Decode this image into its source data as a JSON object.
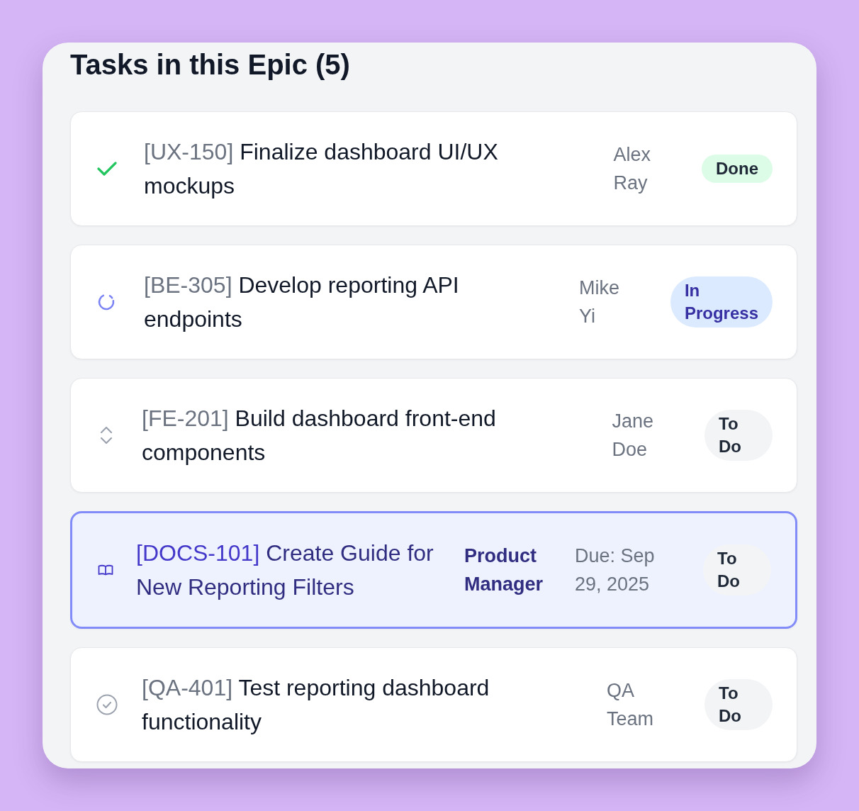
{
  "panel": {
    "title": "Tasks in this Epic (5)"
  },
  "tasks": [
    {
      "kind": "done",
      "selected": false,
      "key": "[UX-150]",
      "title": "Finalize dashboard UI/UX mockups",
      "assignee": "Alex Ray",
      "status": {
        "kind": "done",
        "label": "Done"
      }
    },
    {
      "kind": "in_progress",
      "selected": false,
      "key": "[BE-305]",
      "title": "Develop reporting API endpoints",
      "assignee": "Mike Yi",
      "status": {
        "kind": "in_progress",
        "label": "In Progress"
      }
    },
    {
      "kind": "todo",
      "selected": false,
      "key": "[FE-201]",
      "title": "Build dashboard front-end components",
      "assignee": "Jane Doe",
      "status": {
        "kind": "todo",
        "label": "To Do"
      }
    },
    {
      "kind": "doc",
      "selected": true,
      "key": "[DOCS-101]",
      "title": "Create Guide for New Reporting Filters",
      "role": "Product Manager",
      "due": "Due: Sep 29, 2025",
      "status": {
        "kind": "todo",
        "label": "To Do"
      }
    },
    {
      "kind": "test",
      "selected": false,
      "key": "[QA-401]",
      "title": "Test reporting dashboard functionality",
      "assignee": "QA Team",
      "status": {
        "kind": "todo",
        "label": "To Do"
      }
    }
  ]
}
